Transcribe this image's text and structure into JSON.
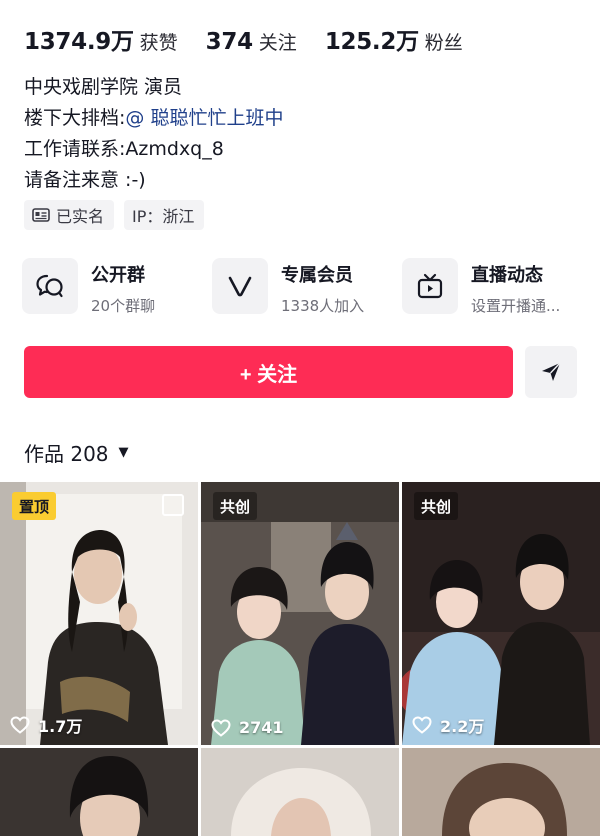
{
  "stats": [
    {
      "value": "1374.9万",
      "label": "获赞"
    },
    {
      "value": "374",
      "label": "关注"
    },
    {
      "value": "125.2万",
      "label": "粉丝"
    }
  ],
  "bio": {
    "line1": "中央戏剧学院 演员",
    "line2_prefix": "楼下大排档:",
    "line2_link": "@ 聪聪忙忙上班中",
    "line3": "工作请联系:Azmdxq_8",
    "line4": "请备注来意 :-)"
  },
  "tags": {
    "verified": "已实名",
    "ip": "IP：浙江"
  },
  "entries": [
    {
      "title": "公开群",
      "sub": "20个群聊",
      "icon": "group-chat-icon"
    },
    {
      "title": "专属会员",
      "sub": "1338人加入",
      "icon": "v-member-icon"
    },
    {
      "title": "直播动态",
      "sub": "设置开播通...",
      "icon": "live-tv-icon"
    }
  ],
  "follow_label": "+ 关注",
  "works": {
    "label": "作品 208",
    "caret": "▼"
  },
  "videos": [
    {
      "badge": "置顶",
      "likes": "1.7万",
      "bg": "#6b6259"
    },
    {
      "badge": "共创",
      "likes": "2741",
      "bg": "#4f4845"
    },
    {
      "badge": "共创",
      "likes": "2.2万",
      "bg": "#2e2524"
    },
    {
      "badge": "",
      "likes": "",
      "bg": "#3a3431"
    },
    {
      "badge": "",
      "likes": "",
      "bg": "#cfc8c2"
    },
    {
      "badge": "",
      "likes": "",
      "bg": "#6f5e55"
    }
  ],
  "colors": {
    "accent": "#fe2c55",
    "pin_badge": "#facc31",
    "link": "#1f3f8a"
  }
}
